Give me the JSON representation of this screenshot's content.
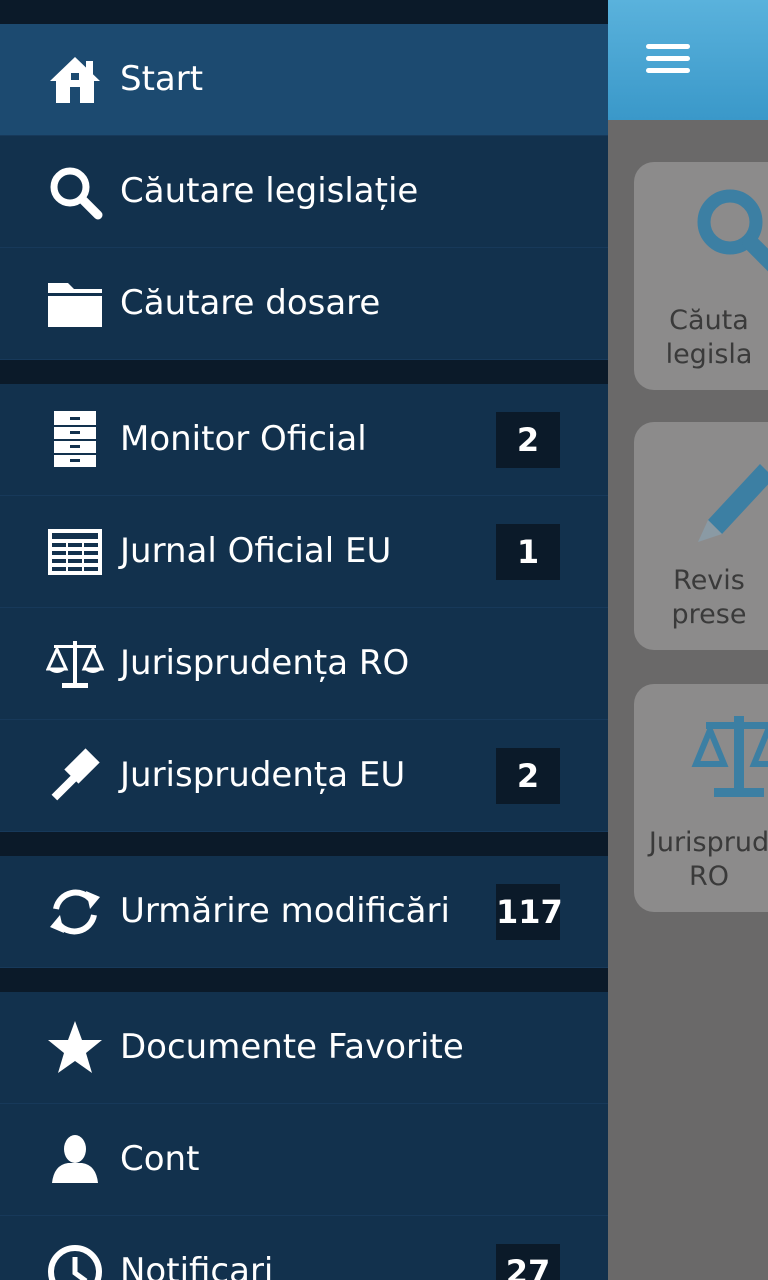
{
  "topbar": {
    "menu_icon": "hamburger-icon"
  },
  "tiles": [
    {
      "label": "Căuta\nlegisla",
      "icon": "search-icon"
    },
    {
      "label": "Revis\nprese",
      "icon": "pencil-icon"
    },
    {
      "label": "Jurisprud\nRO",
      "icon": "scales-icon"
    }
  ],
  "menu": {
    "group1": [
      {
        "label": "Start",
        "icon": "home-icon",
        "active": true
      },
      {
        "label": "Căutare legislație",
        "icon": "search-icon"
      },
      {
        "label": "Căutare dosare",
        "icon": "folder-icon"
      }
    ],
    "group2": [
      {
        "label": "Monitor Oficial",
        "icon": "cabinet-icon",
        "badge": "2"
      },
      {
        "label": "Jurnal Oficial EU",
        "icon": "newspaper-icon",
        "badge": "1"
      },
      {
        "label": "Jurisprudența RO",
        "icon": "scales-icon"
      },
      {
        "label": "Jurisprudența EU",
        "icon": "gavel-icon",
        "badge": "2"
      }
    ],
    "group3": [
      {
        "label": "Urmărire modificări",
        "icon": "refresh-icon",
        "badge": "117"
      }
    ],
    "group4": [
      {
        "label": "Documente Favorite",
        "icon": "star-icon"
      },
      {
        "label": "Cont",
        "icon": "user-icon"
      },
      {
        "label": "Notificari",
        "icon": "clock-icon",
        "badge": "27"
      }
    ]
  },
  "colors": {
    "drawer_bg": "#12314d",
    "active_bg": "#1c4a70",
    "divider": "#0b1a29",
    "accent": "#3a98c9",
    "tile_icon": "#3c7fa3"
  }
}
